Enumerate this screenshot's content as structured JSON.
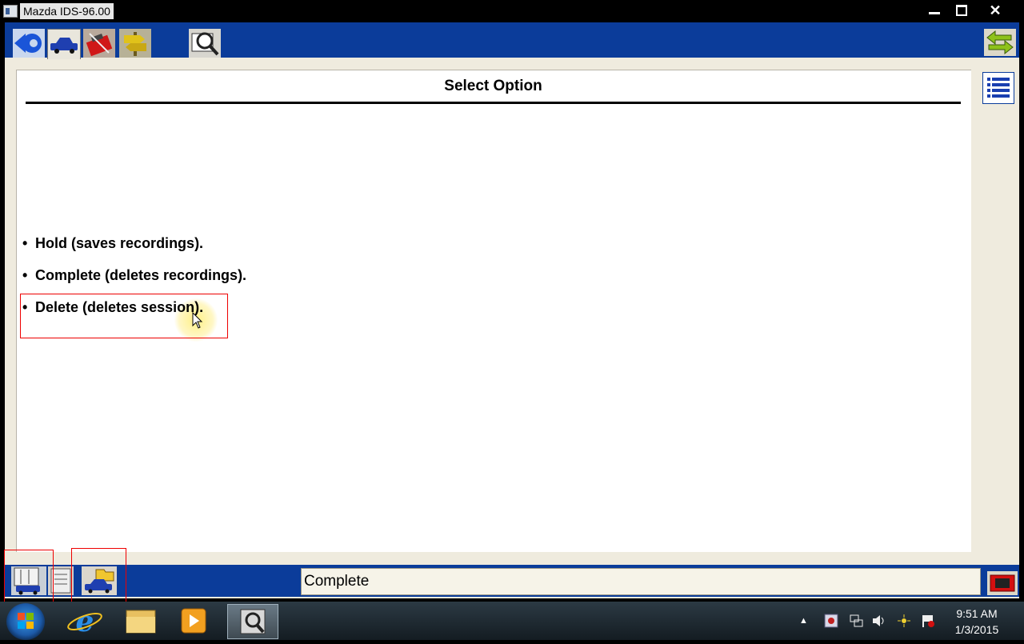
{
  "window": {
    "title": "Mazda IDS-96.00"
  },
  "toolbar": {
    "icons": [
      "back-arrow-icon",
      "vehicle-icon",
      "toolbox-icon",
      "signpost-icon",
      "inspect-icon",
      "swap-arrows-icon"
    ]
  },
  "main": {
    "title": "Select Option",
    "options": [
      {
        "label": "Hold (saves recordings)."
      },
      {
        "label": "Complete (deletes recordings)."
      },
      {
        "label": "Delete (deletes session)."
      }
    ],
    "bullet": "•"
  },
  "status": {
    "text": "Complete"
  },
  "clock": {
    "time": "9:51 AM",
    "date": "1/3/2015"
  },
  "colors": {
    "toolbar_blue": "#0b3c9a",
    "panel_beige": "#efebde",
    "highlight_red": "#e00000"
  }
}
